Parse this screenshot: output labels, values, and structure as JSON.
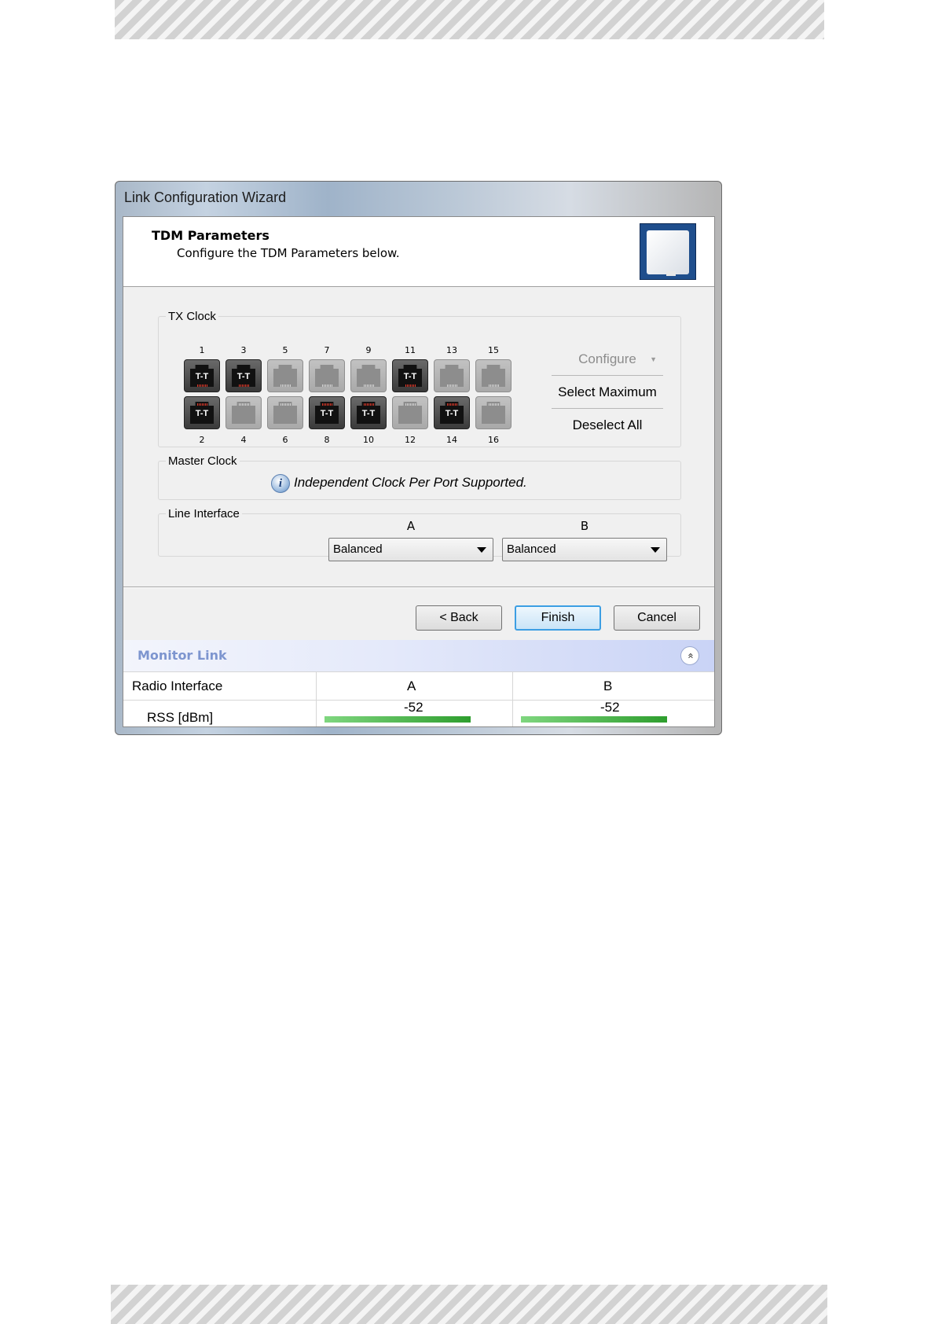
{
  "window": {
    "title": "Link Configuration Wizard"
  },
  "header": {
    "title": "TDM Parameters",
    "subtitle": "Configure the TDM Parameters below.",
    "icon": "antenna-panel-icon"
  },
  "tx_clock": {
    "legend": "TX Clock",
    "ports": [
      {
        "num": "1",
        "label": "T-T",
        "active": true
      },
      {
        "num": "3",
        "label": "T-T",
        "active": true
      },
      {
        "num": "5",
        "label": "",
        "active": false
      },
      {
        "num": "7",
        "label": "",
        "active": false
      },
      {
        "num": "9",
        "label": "",
        "active": false
      },
      {
        "num": "11",
        "label": "T-T",
        "active": true
      },
      {
        "num": "13",
        "label": "",
        "active": false
      },
      {
        "num": "15",
        "label": "",
        "active": false
      },
      {
        "num": "2",
        "label": "T-T",
        "active": true
      },
      {
        "num": "4",
        "label": "",
        "active": false
      },
      {
        "num": "6",
        "label": "",
        "active": false
      },
      {
        "num": "8",
        "label": "T-T",
        "active": true
      },
      {
        "num": "10",
        "label": "T-T",
        "active": true
      },
      {
        "num": "12",
        "label": "",
        "active": false
      },
      {
        "num": "14",
        "label": "T-T",
        "active": true
      },
      {
        "num": "16",
        "label": "",
        "active": false
      }
    ],
    "actions": {
      "configure": "Configure",
      "select_maximum": "Select Maximum",
      "deselect_all": "Deselect All"
    }
  },
  "master_clock": {
    "legend": "Master Clock",
    "info": "Independent Clock Per Port Supported.",
    "info_glyph": "i"
  },
  "line_interface": {
    "legend": "Line Interface",
    "col_a": "A",
    "col_b": "B",
    "value_a": "Balanced",
    "value_b": "Balanced"
  },
  "buttons": {
    "back": "< Back",
    "finish": "Finish",
    "cancel": "Cancel"
  },
  "monitor": {
    "title": "Monitor Link",
    "collapse_glyph": "«",
    "table": {
      "col0": "Radio Interface",
      "col1": "A",
      "col2": "B",
      "row_label": "RSS [dBm]",
      "value_a": "-52",
      "value_b": "-52"
    }
  },
  "colors": {
    "accent": "#3c9ee3",
    "monitor_title": "#7d95cf",
    "rss_bar": "#2e9e2e",
    "port_active_pins": "#e23a2a"
  }
}
